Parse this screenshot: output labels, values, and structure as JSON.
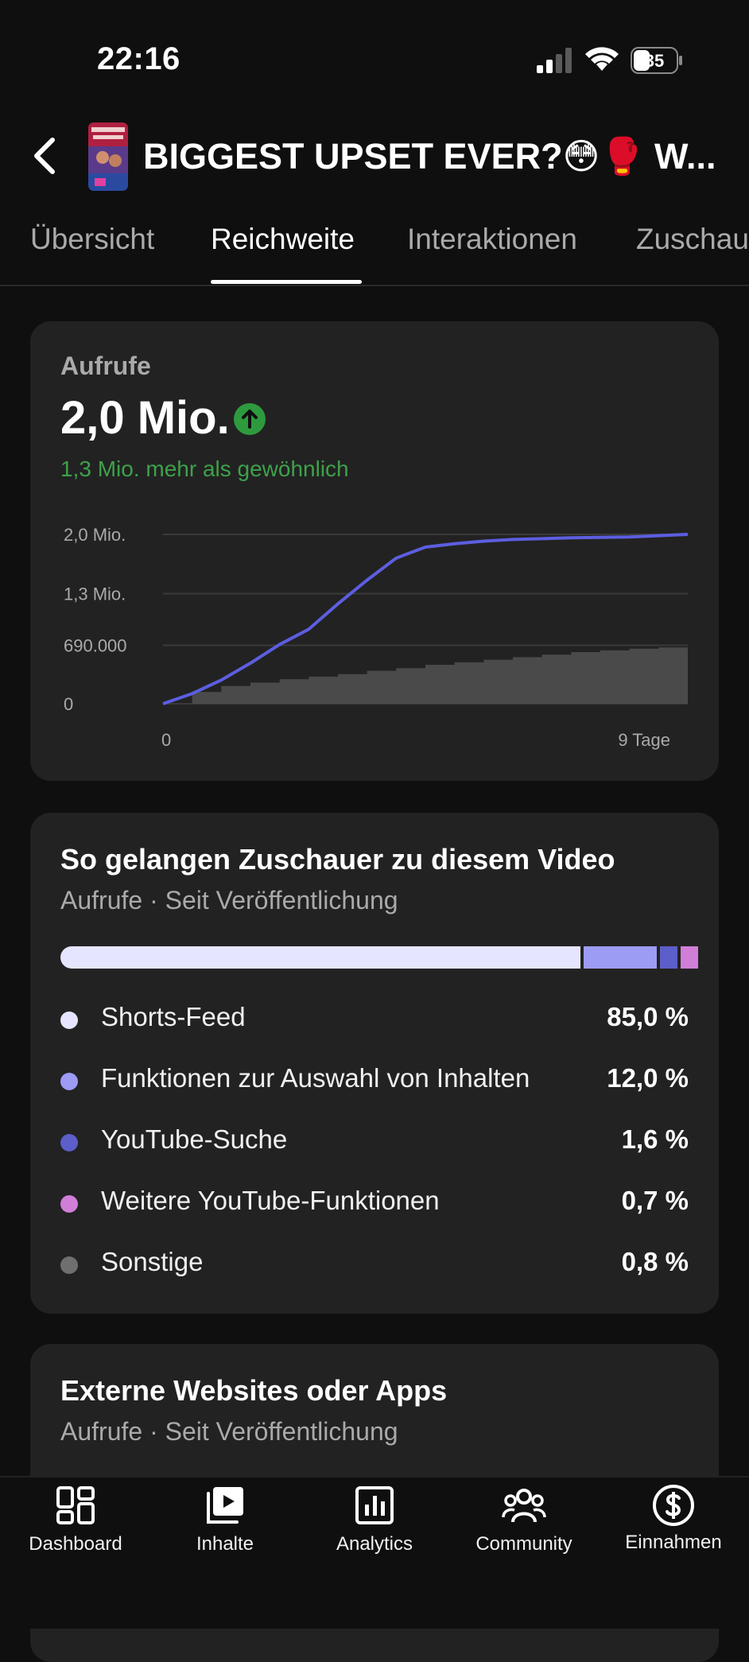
{
  "status_bar": {
    "time": "22:16",
    "battery": "35"
  },
  "header": {
    "title": "BIGGEST UPSET EVER?😳🥊 W...",
    "back_icon": "chevron-left-icon"
  },
  "tabs": [
    {
      "label": "Übersicht",
      "active": false
    },
    {
      "label": "Reichweite",
      "active": true
    },
    {
      "label": "Interaktionen",
      "active": false
    },
    {
      "label": "Zuschau",
      "active": false
    }
  ],
  "views_card": {
    "label": "Aufrufe",
    "value": "2,0 Mio.",
    "trend_icon": "arrow-up-icon",
    "delta": "1,3 Mio. mehr als gewöhnlich"
  },
  "chart_data": {
    "type": "line",
    "y_ticks": [
      "2,0 Mio.",
      "1,3 Mio.",
      "690.000",
      "0"
    ],
    "y_tick_values": [
      2000000,
      1300000,
      690000,
      0
    ],
    "x_ticks": [
      "0",
      "9 Tage"
    ],
    "xlim": [
      0,
      9
    ],
    "ylim": [
      0,
      2000000
    ],
    "grid": true,
    "series": [
      {
        "role": "video",
        "color": "#5c5ee0",
        "x": [
          0,
          0.5,
          1,
          1.5,
          2,
          2.5,
          3,
          3.5,
          4,
          4.5,
          5,
          5.5,
          6,
          6.5,
          7,
          7.5,
          8,
          8.5,
          9
        ],
        "y": [
          0,
          120000,
          280000,
          480000,
          700000,
          880000,
          1180000,
          1460000,
          1720000,
          1850000,
          1890000,
          1920000,
          1940000,
          1950000,
          1960000,
          1965000,
          1970000,
          1985000,
          2000000
        ]
      },
      {
        "role": "typical",
        "color": "#4a4a4a",
        "x": [
          0,
          0.5,
          1,
          1.5,
          2,
          2.5,
          3,
          3.5,
          4,
          4.5,
          5,
          5.5,
          6,
          6.5,
          7,
          7.5,
          8,
          8.5,
          9
        ],
        "y": [
          0,
          140000,
          210000,
          250000,
          290000,
          320000,
          350000,
          390000,
          420000,
          460000,
          490000,
          520000,
          550000,
          580000,
          610000,
          630000,
          650000,
          665000,
          680000
        ]
      }
    ]
  },
  "traffic_card": {
    "title": "So gelangen Zuschauer zu diesem Video",
    "subtitle": "Aufrufe · Seit Veröffentlichung",
    "sources": [
      {
        "label": "Shorts-Feed",
        "value": "85,0 %",
        "share": 85.0,
        "color": "#e6e5ff"
      },
      {
        "label": "Funktionen zur Auswahl von Inhalten",
        "value": "12,0 %",
        "share": 12.0,
        "color": "#9c9cf5"
      },
      {
        "label": "YouTube-Suche",
        "value": "1,6 %",
        "share": 1.6,
        "color": "#5c5ec9"
      },
      {
        "label": "Weitere YouTube-Funktionen",
        "value": "0,7 %",
        "share": 0.7,
        "color": "#d17ed8"
      },
      {
        "label": "Sonstige",
        "value": "0,8 %",
        "share": 0.8,
        "color": "#6f6f6f"
      }
    ]
  },
  "external_card": {
    "title": "Externe Websites oder Apps",
    "subtitle": "Aufrufe · Seit Veröffentlichung"
  },
  "bottom_nav": [
    {
      "label": "Dashboard",
      "icon": "dashboard-icon"
    },
    {
      "label": "Inhalte",
      "icon": "content-icon"
    },
    {
      "label": "Analytics",
      "icon": "analytics-icon"
    },
    {
      "label": "Community",
      "icon": "community-icon"
    },
    {
      "label": "Einnahmen",
      "icon": "dollar-icon"
    }
  ]
}
